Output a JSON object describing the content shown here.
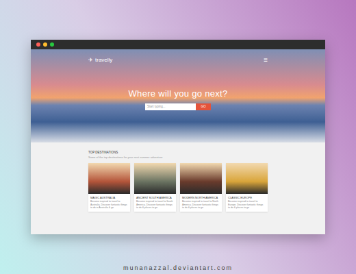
{
  "browser": {
    "dots": [
      {
        "color": "#ff5f57"
      },
      {
        "color": "#febc2e"
      },
      {
        "color": "#28c840"
      }
    ]
  },
  "header": {
    "logo_icon": "✈",
    "logo": "travelly",
    "menu_icon": "≡"
  },
  "hero": {
    "heading": "Where will you go next?",
    "search": {
      "placeholder": "Start typing..."
    },
    "button": "GO"
  },
  "section": {
    "title": "TOP DESTINATIONS",
    "subtitle": "Some of the top destinations for your next summer adventure"
  },
  "destinations": [
    {
      "title": "MAGIC AUSTRALIA",
      "description": "Become inspired to travel to Australia. Discover fantastic things to do in Australia & go",
      "color": "#b4553a"
    },
    {
      "title": "ANCIENT SOUTH AMERICA",
      "description": "Become inspired to travel to South America. Discover fantastic things to do & places to go",
      "color": "#6b7462"
    },
    {
      "title": "MODERN NORTH AMERICA",
      "description": "Become inspired to travel to North America. Discover fantastic things to do & places to go",
      "color": "#6a3b2c"
    },
    {
      "title": "CLASSIC EUROPE",
      "description": "Become inspired to travel to Europe. Discover fantastic things to do & places to go",
      "color": "#d9a53a"
    }
  ],
  "footer": "munanazzal.deviantart.com"
}
